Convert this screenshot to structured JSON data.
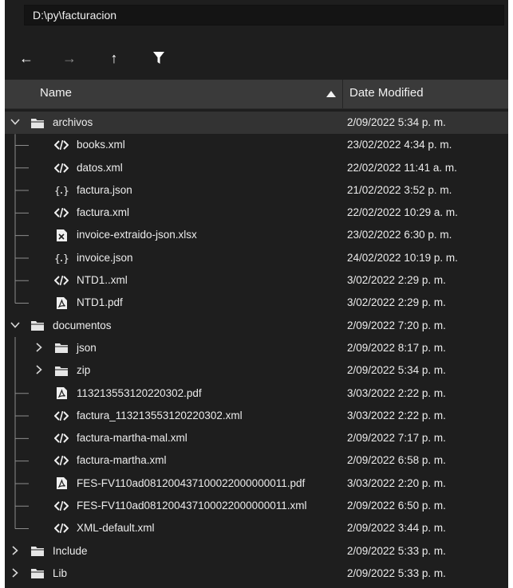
{
  "path": {
    "value": "D:\\py\\facturacion"
  },
  "toolbar": {
    "back": "←",
    "forward": "→",
    "up": "↑",
    "filter": "filter-icon"
  },
  "header": {
    "name_label": "Name",
    "date_label": "Date Modified"
  },
  "rows": [
    {
      "name": "archivos",
      "date": "2/09/2022 5:34 p. m.",
      "kind": "folder",
      "expanded": true,
      "level": 0,
      "selected": true
    },
    {
      "name": "books.xml",
      "date": "23/02/2022 4:34 p. m.",
      "kind": "xml",
      "level": 1
    },
    {
      "name": "datos.xml",
      "date": "22/02/2022 11:41 a. m.",
      "kind": "xml",
      "level": 1
    },
    {
      "name": "factura.json",
      "date": "21/02/2022 3:52 p. m.",
      "kind": "json",
      "level": 1
    },
    {
      "name": "factura.xml",
      "date": "22/02/2022 10:29 a. m.",
      "kind": "xml",
      "level": 1
    },
    {
      "name": "invoice-extraido-json.xlsx",
      "date": "23/02/2022 6:30 p. m.",
      "kind": "xlsx",
      "level": 1
    },
    {
      "name": "invoice.json",
      "date": "24/02/2022 10:19 p. m.",
      "kind": "json",
      "level": 1
    },
    {
      "name": "NTD1..xml",
      "date": "3/02/2022 2:29 p. m.",
      "kind": "xml",
      "level": 1
    },
    {
      "name": "NTD1.pdf",
      "date": "3/02/2022 2:29 p. m.",
      "kind": "pdf",
      "level": 1
    },
    {
      "name": "documentos",
      "date": "2/09/2022 7:20 p. m.",
      "kind": "folder",
      "expanded": true,
      "level": 0
    },
    {
      "name": "json",
      "date": "2/09/2022 8:17 p. m.",
      "kind": "folder",
      "expanded": false,
      "level": 1
    },
    {
      "name": "zip",
      "date": "2/09/2022 5:34 p. m.",
      "kind": "folder",
      "expanded": false,
      "level": 1
    },
    {
      "name": "113213553120220302.pdf",
      "date": "3/03/2022 2:22 p. m.",
      "kind": "pdf",
      "level": 1
    },
    {
      "name": "factura_113213553120220302.xml",
      "date": "3/03/2022 2:22 p. m.",
      "kind": "xml",
      "level": 1
    },
    {
      "name": "factura-martha-mal.xml",
      "date": "2/09/2022 7:17 p. m.",
      "kind": "xml",
      "level": 1
    },
    {
      "name": "factura-martha.xml",
      "date": "2/09/2022 6:58 p. m.",
      "kind": "xml",
      "level": 1
    },
    {
      "name": "FES-FV110ad081200437100022000000011.pdf",
      "date": "3/03/2022 2:20 p. m.",
      "kind": "pdf",
      "level": 1
    },
    {
      "name": "FES-FV110ad081200437100022000000011.xml",
      "date": "2/09/2022 6:50 p. m.",
      "kind": "xml",
      "level": 1
    },
    {
      "name": "XML-default.xml",
      "date": "2/09/2022 3:44 p. m.",
      "kind": "xml",
      "level": 1
    },
    {
      "name": "Include",
      "date": "2/09/2022 5:33 p. m.",
      "kind": "folder",
      "expanded": false,
      "level": 0
    },
    {
      "name": "Lib",
      "date": "2/09/2022 5:33 p. m.",
      "kind": "folder",
      "expanded": false,
      "level": 0
    }
  ],
  "colors": {
    "background": "#1e1e1e",
    "header": "#3a3a3a",
    "selected_row": "#333333",
    "text": "#ececec",
    "tree_line": "#8c8c8c"
  }
}
